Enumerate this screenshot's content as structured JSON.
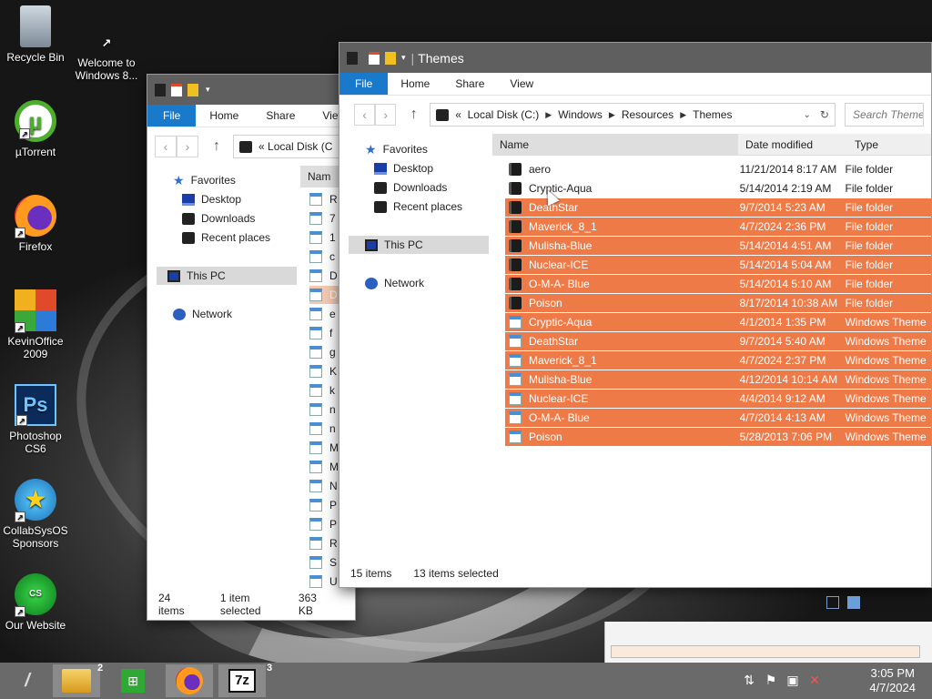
{
  "desktop": {
    "icons": [
      {
        "label": "Recycle Bin",
        "icon": "recycle-bin-icon"
      },
      {
        "label": "Welcome to Windows 8...",
        "icon": "shortcut-icon"
      },
      {
        "label": "µTorrent",
        "icon": "utorrent-icon"
      },
      {
        "label": "Firefox",
        "icon": "firefox-icon"
      },
      {
        "label": "KevinOffice 2009",
        "icon": "office-icon"
      },
      {
        "label": "Photoshop CS6",
        "icon": "photoshop-icon"
      },
      {
        "label": "CollabSysOS Sponsors",
        "icon": "globe-star-icon"
      },
      {
        "label": "Our Website",
        "icon": "website-icon"
      }
    ]
  },
  "ribbon": {
    "file": "File",
    "home": "Home",
    "share": "Share",
    "view": "View",
    "view_cut": "Viev"
  },
  "front_window": {
    "title": "Themes",
    "address": {
      "prefix": "«",
      "parts": [
        "Local Disk (C:)",
        "Windows",
        "Resources",
        "Themes"
      ]
    },
    "search_placeholder": "Search Themes",
    "nav": {
      "favorites": "Favorites",
      "desktop": "Desktop",
      "downloads": "Downloads",
      "recent": "Recent places",
      "this_pc": "This PC",
      "network": "Network"
    },
    "columns": {
      "name": "Name",
      "date": "Date modified",
      "type": "Type"
    },
    "files": [
      {
        "name": "aero",
        "date": "11/21/2014 8:17 AM",
        "type": "File folder",
        "kind": "folder",
        "selected": false
      },
      {
        "name": "Cryptic-Aqua",
        "date": "5/14/2014 2:19 AM",
        "type": "File folder",
        "kind": "folder",
        "selected": false
      },
      {
        "name": "DeathStar",
        "date": "9/7/2014 5:23 AM",
        "type": "File folder",
        "kind": "folder",
        "selected": true
      },
      {
        "name": "Maverick_8_1",
        "date": "4/7/2024 2:36 PM",
        "type": "File folder",
        "kind": "folder",
        "selected": true
      },
      {
        "name": "Mulisha-Blue",
        "date": "5/14/2014 4:51 AM",
        "type": "File folder",
        "kind": "folder",
        "selected": true
      },
      {
        "name": "Nuclear-ICE",
        "date": "5/14/2014 5:04 AM",
        "type": "File folder",
        "kind": "folder",
        "selected": true
      },
      {
        "name": "O-M-A- Blue",
        "date": "5/14/2014 5:10 AM",
        "type": "File folder",
        "kind": "folder",
        "selected": true
      },
      {
        "name": "Poison",
        "date": "8/17/2014 10:38 AM",
        "type": "File folder",
        "kind": "folder",
        "selected": true
      },
      {
        "name": "Cryptic-Aqua",
        "date": "4/1/2014 1:35 PM",
        "type": "Windows Theme",
        "kind": "theme",
        "selected": true
      },
      {
        "name": "DeathStar",
        "date": "9/7/2014 5:40 AM",
        "type": "Windows Theme",
        "kind": "theme",
        "selected": true
      },
      {
        "name": "Maverick_8_1",
        "date": "4/7/2024 2:37 PM",
        "type": "Windows Theme",
        "kind": "theme",
        "selected": true
      },
      {
        "name": "Mulisha-Blue",
        "date": "4/12/2014 10:14 AM",
        "type": "Windows Theme",
        "kind": "theme",
        "selected": true
      },
      {
        "name": "Nuclear-ICE",
        "date": "4/4/2014 9:12 AM",
        "type": "Windows Theme",
        "kind": "theme",
        "selected": true
      },
      {
        "name": "O-M-A- Blue",
        "date": "4/7/2014 4:13 AM",
        "type": "Windows Theme",
        "kind": "theme",
        "selected": true
      },
      {
        "name": "Poison",
        "date": "5/28/2013 7:06 PM",
        "type": "Windows Theme",
        "kind": "theme",
        "selected": true
      }
    ],
    "status": {
      "count": "15 items",
      "selected": "13 items selected"
    }
  },
  "back_window": {
    "address": {
      "prefix": "«",
      "text": "Local Disk (C"
    },
    "nav": {
      "favorites": "Favorites",
      "desktop": "Desktop",
      "downloads": "Downloads",
      "recent": "Recent places",
      "this_pc": "This PC",
      "network": "Network"
    },
    "column": "Nam",
    "files": [
      "R",
      "7",
      "1",
      "c",
      "D",
      "D",
      "e",
      "f",
      "g",
      "K",
      "k",
      "n",
      "n",
      "M",
      "M",
      "N",
      "P",
      "P",
      "R",
      "S",
      "U"
    ],
    "status": {
      "count": "24 items",
      "selected": "1 item selected",
      "size": "363 KB"
    }
  },
  "taskbar": {
    "explorer_badge": "2",
    "sevenzip_badge": "3",
    "sevenzip_label": "7z",
    "time": "3:05 PM",
    "date": "4/7/2024"
  },
  "colors": {
    "selection": "#ee7a47",
    "file_tab": "#1979ca",
    "titlebar": "#5f5f5f",
    "taskbar": "#6a6a6a"
  }
}
